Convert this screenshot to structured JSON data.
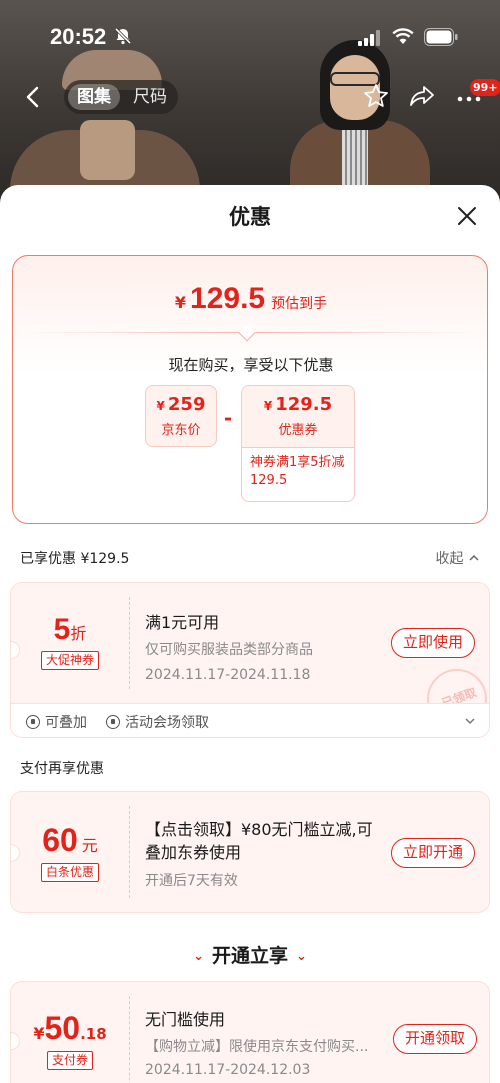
{
  "status": {
    "time": "20:52"
  },
  "nav": {
    "tab_images": "图集",
    "tab_size": "尺码",
    "badge": "99+"
  },
  "sheet": {
    "title": "优惠"
  },
  "summary": {
    "yen": "¥",
    "price": "129.5",
    "note": "预估到手",
    "subtitle": "现在购买，享受以下优惠",
    "jd_price": {
      "yen": "¥",
      "value": "259",
      "label": "京东价"
    },
    "minus": "-",
    "coupon": {
      "yen": "¥",
      "value": "129.5",
      "label": "优惠券",
      "desc": "神券满1享5折减129.5"
    }
  },
  "enjoyed": {
    "label": "已享优惠 ¥129.5",
    "collapse": "收起"
  },
  "coupon1": {
    "amount": "5",
    "unit": "折",
    "tag": "大促神券",
    "title": "满1元可用",
    "desc": "仅可购买服装品类部分商品",
    "validity": "2024.11.17-2024.11.18",
    "button": "立即使用",
    "stamp": "已领取"
  },
  "props": {
    "stackable": "可叠加",
    "source": "活动会场领取"
  },
  "pay_section": {
    "label": "支付再享优惠"
  },
  "coupon2": {
    "amount": "60",
    "unit": "元",
    "tag": "白条优惠",
    "title": "【点击领取】¥80无门槛立减,可叠加东券使用",
    "desc": "开通后7天有效",
    "button": "立即开通"
  },
  "open_divider": {
    "title": "开通立享"
  },
  "coupon3": {
    "yen": "¥",
    "amount": "50",
    "decimal": ".18",
    "tag": "支付券",
    "title": "无门槛使用",
    "desc": "【购物立减】限使用京东支付购买...",
    "validity": "2024.11.17-2024.12.03",
    "button": "开通领取"
  },
  "colors": {
    "accent": "#e2231a",
    "card_bg": "#fff4f1"
  },
  "icons": [
    "bell-off-icon",
    "signal-icon",
    "wifi-icon",
    "battery-icon",
    "back-icon",
    "star-icon",
    "share-icon",
    "more-icon",
    "close-icon",
    "chevron-up-icon",
    "chevron-down-icon"
  ]
}
